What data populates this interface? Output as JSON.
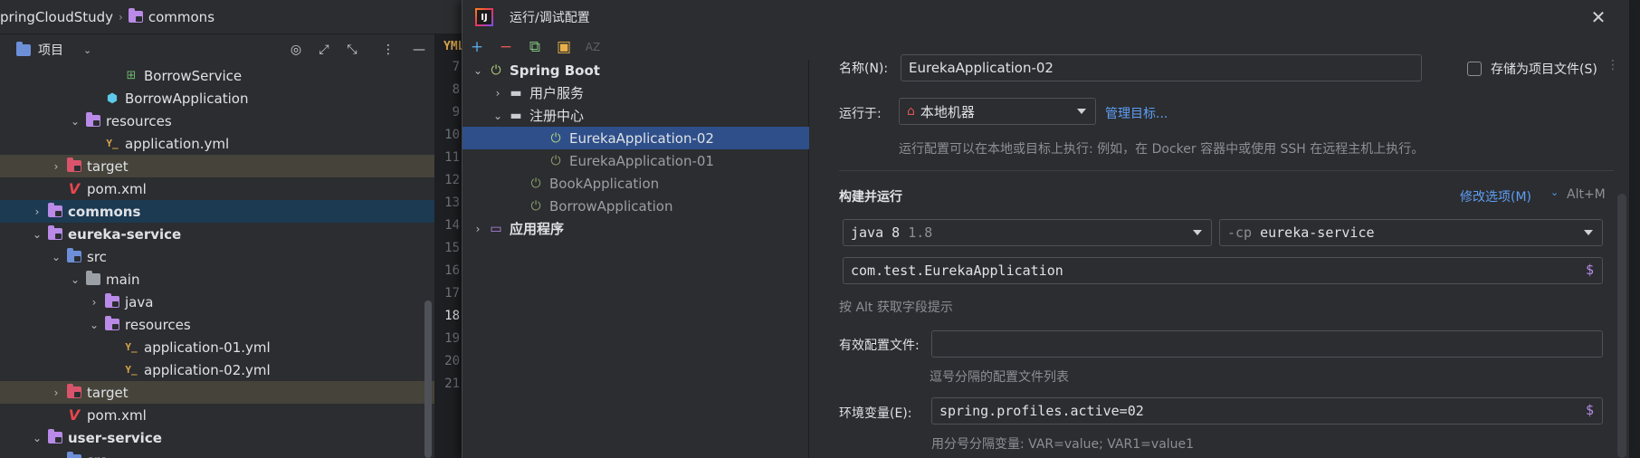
{
  "breadcrumb": {
    "project": "pringCloudStudy",
    "module": "commons"
  },
  "project_panel": {
    "title": "项目"
  },
  "tree": [
    {
      "label": "BorrowService",
      "type": "bean",
      "indent": 5,
      "bold": false
    },
    {
      "label": "BorrowApplication",
      "type": "spring",
      "indent": 4,
      "bold": false
    },
    {
      "label": "resources",
      "type": "resfolder",
      "indent": 3,
      "chevron": "down",
      "bold": false
    },
    {
      "label": "application.yml",
      "type": "yml",
      "indent": 4,
      "bold": false
    },
    {
      "label": "target",
      "type": "target",
      "indent": 2,
      "chevron": "right",
      "bold": false,
      "hl": "target"
    },
    {
      "label": "pom.xml",
      "type": "maven",
      "indent": 2,
      "bold": false
    },
    {
      "label": "commons",
      "type": "module",
      "indent": 1,
      "chevron": "right",
      "bold": true,
      "hl": "selected"
    },
    {
      "label": "eureka-service",
      "type": "module",
      "indent": 1,
      "chevron": "down",
      "bold": true
    },
    {
      "label": "src",
      "type": "src",
      "indent": 2,
      "chevron": "down",
      "bold": false
    },
    {
      "label": "main",
      "type": "folder",
      "indent": 3,
      "chevron": "down",
      "bold": false
    },
    {
      "label": "java",
      "type": "javafolder",
      "indent": 4,
      "chevron": "right",
      "bold": false
    },
    {
      "label": "resources",
      "type": "resfolder",
      "indent": 4,
      "chevron": "down",
      "bold": false
    },
    {
      "label": "application-01.yml",
      "type": "yml",
      "indent": 5,
      "bold": false
    },
    {
      "label": "application-02.yml",
      "type": "yml",
      "indent": 5,
      "bold": false
    },
    {
      "label": "target",
      "type": "target",
      "indent": 2,
      "chevron": "right",
      "bold": false,
      "hl": "target"
    },
    {
      "label": "pom.xml",
      "type": "maven",
      "indent": 2,
      "bold": false
    },
    {
      "label": "user-service",
      "type": "module",
      "indent": 1,
      "chevron": "down",
      "bold": true
    },
    {
      "label": "src",
      "type": "src",
      "indent": 2,
      "chevron": "down",
      "bold": false
    }
  ],
  "gutter_lines": [
    "7",
    "8",
    "9",
    "10",
    "11",
    "12",
    "13",
    "14",
    "15",
    "16",
    "17",
    "18",
    "19",
    "20",
    "21"
  ],
  "current_line": "18",
  "editor_tab_icon": "YML",
  "dialog": {
    "title": "运行/调试配置",
    "logo_text": "IJ",
    "config_tree": [
      {
        "label": "Spring Boot",
        "icon": "power-on",
        "indent": 0,
        "chevron": "down",
        "bold": true
      },
      {
        "label": "用户服务",
        "icon": "folder",
        "indent": 1,
        "chevron": "right"
      },
      {
        "label": "注册中心",
        "icon": "folder",
        "indent": 1,
        "chevron": "down"
      },
      {
        "label": "EurekaApplication-02",
        "icon": "power-on",
        "indent": 3,
        "selected": true
      },
      {
        "label": "EurekaApplication-01",
        "icon": "power-off",
        "indent": 3,
        "dim": true
      },
      {
        "label": "BookApplication",
        "icon": "power-off",
        "indent": 2,
        "dim": true
      },
      {
        "label": "BorrowApplication",
        "icon": "power-off",
        "indent": 2,
        "dim": true
      },
      {
        "label": "应用程序",
        "icon": "app",
        "indent": 0,
        "chevron": "right",
        "bold": true
      }
    ],
    "form": {
      "name_label": "名称(N):",
      "name_value": "EurekaApplication-02",
      "store_as_file_label": "存储为项目文件(S)",
      "run_on_label": "运行于:",
      "run_on_value": "本地机器",
      "manage_targets": "管理目标...",
      "run_on_hint": "运行配置可以在本地或目标上执行: 例如，在 Docker 容器中或使用 SSH 在远程主机上执行。",
      "build_run_title": "构建并运行",
      "modify_options": "修改选项(M)",
      "modify_shortcut": "Alt+M",
      "jdk_value": "java 8",
      "jdk_version": "1.8",
      "cp_prefix": "-cp",
      "cp_value": "eureka-service",
      "main_class": "com.test.EurekaApplication",
      "alt_hint": "按 Alt 获取字段提示",
      "profiles_label": "有效配置文件:",
      "profiles_value": "",
      "profiles_hint": "逗号分隔的配置文件列表",
      "env_label": "环境变量(E):",
      "env_value": "spring.profiles.active=02",
      "env_hint": "用分号分隔变量: VAR=value; VAR1=value1"
    }
  },
  "colors": {
    "accent_link": "#5f9ef5",
    "selection": "#2e4f8a",
    "spring_green": "#b3d27a"
  }
}
